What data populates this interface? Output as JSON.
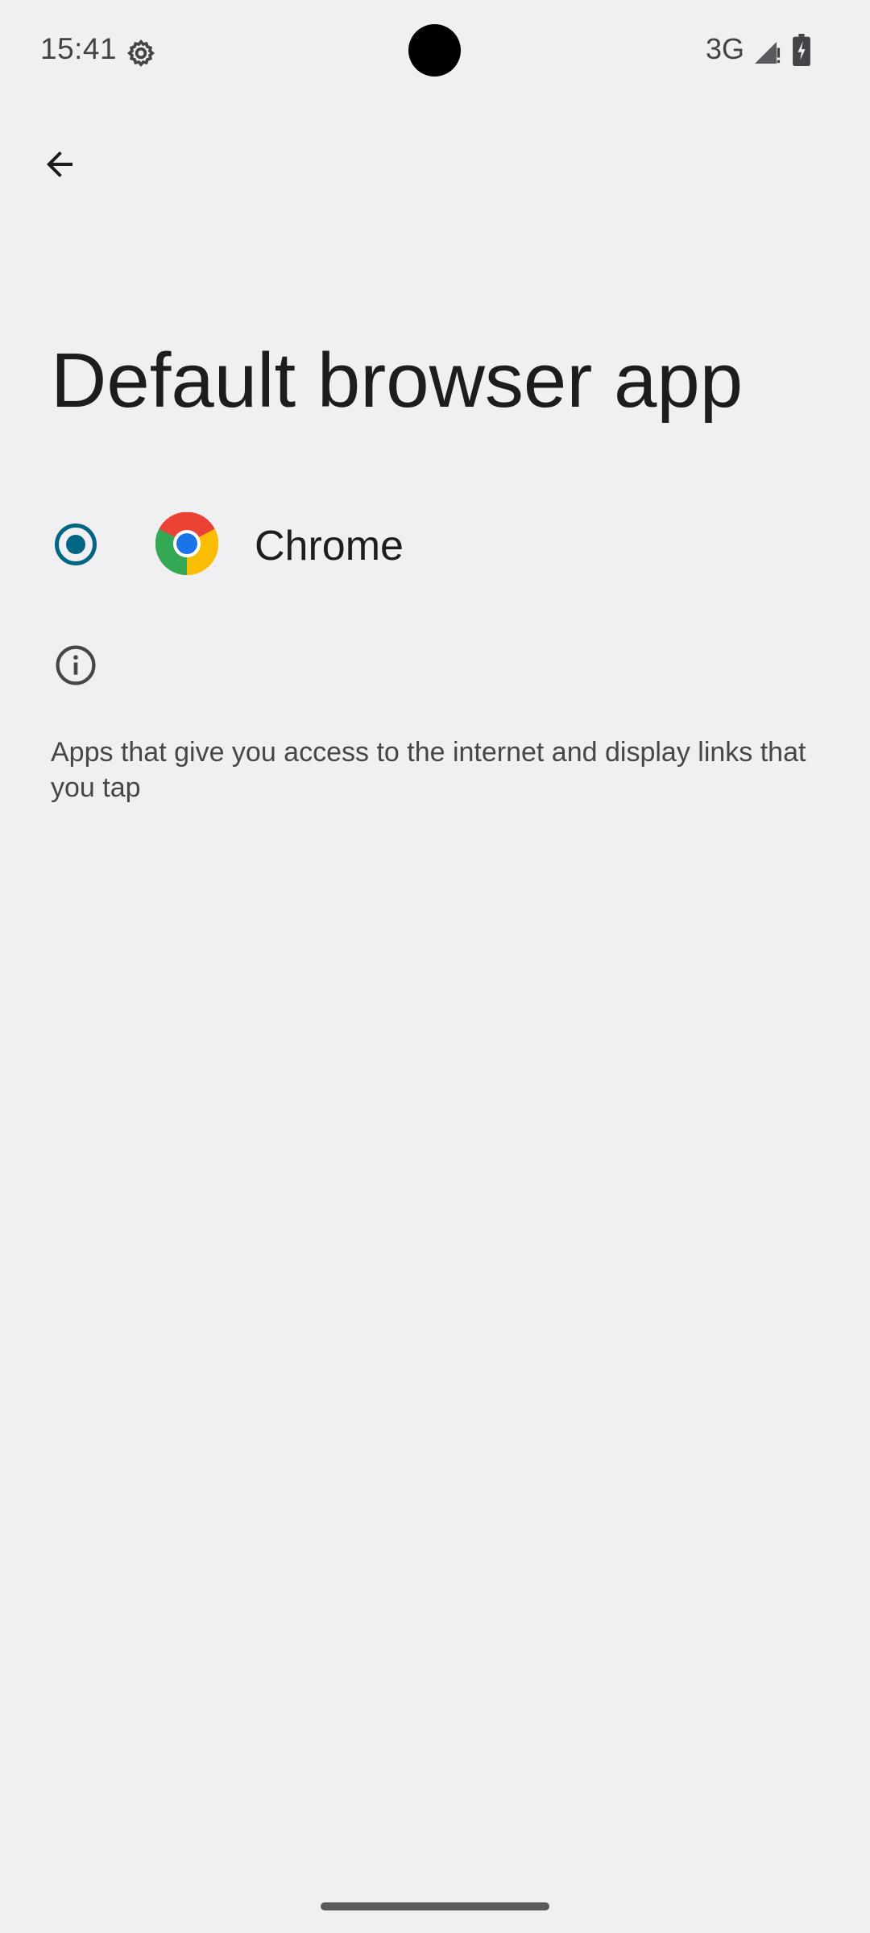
{
  "status_bar": {
    "time": "15:41",
    "network": "3G",
    "icons": [
      "settings-icon",
      "signal-icon",
      "battery-charging-icon"
    ]
  },
  "toolbar": {
    "back_icon": "arrow-back-icon"
  },
  "page": {
    "title": "Default browser app"
  },
  "apps": [
    {
      "label": "Chrome",
      "selected": true,
      "icon": "chrome-icon"
    }
  ],
  "footer": {
    "info_icon": "info-icon",
    "description": "Apps that give you access to the internet and display links that you tap"
  },
  "colors": {
    "background": "#f0f0f3",
    "accent": "#006684",
    "title": "#1d1d20",
    "secondary_text": "#46464a"
  }
}
